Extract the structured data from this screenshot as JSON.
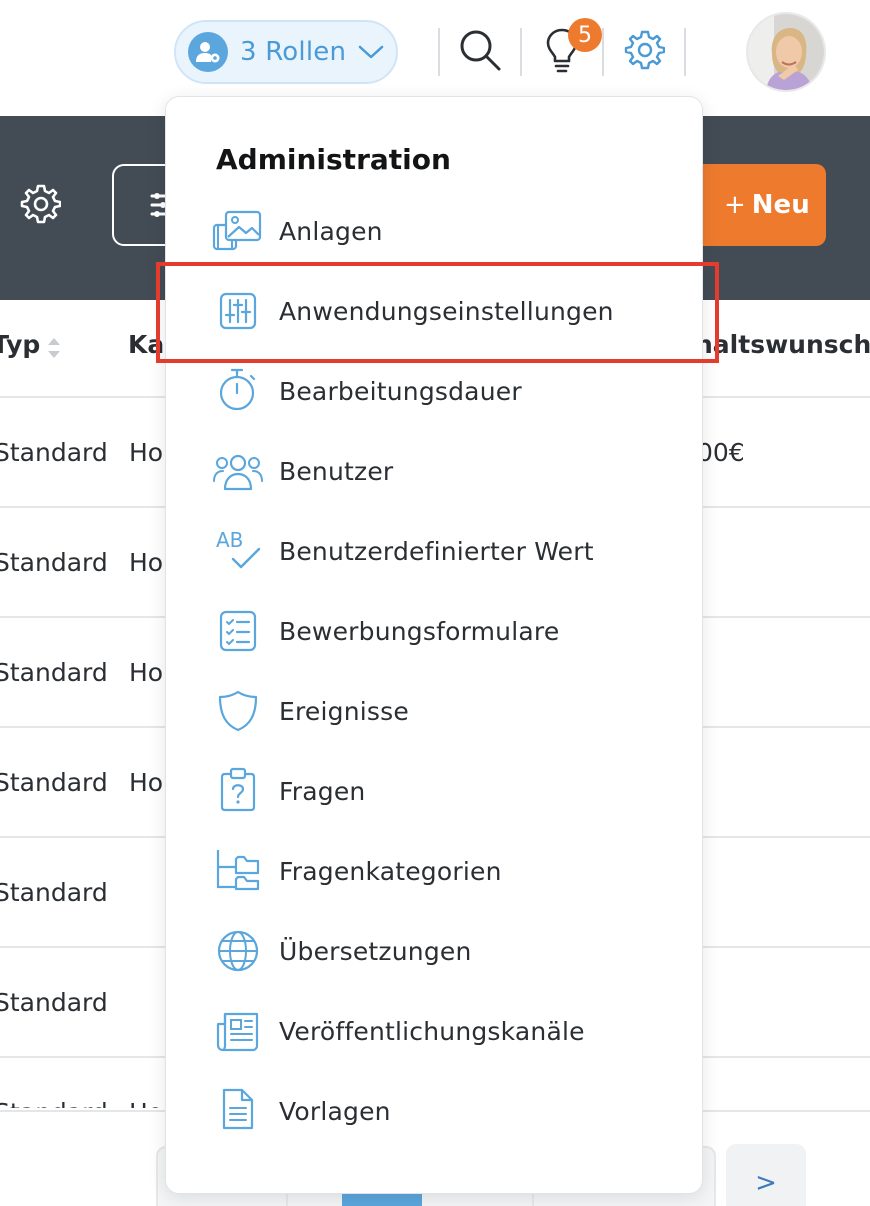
{
  "header": {
    "roles_label": "3 Rollen",
    "notification_count": "5",
    "icons": [
      "user-gear-icon",
      "chevron-down-icon",
      "search-icon",
      "lightbulb-icon",
      "gear-icon",
      "avatar"
    ]
  },
  "toolbar": {
    "new_button_label": "Neu",
    "icons": [
      "gear-icon",
      "filter-icon",
      "plus-icon"
    ]
  },
  "table": {
    "headers": [
      "Typ",
      "Ka",
      "haltswunsch"
    ],
    "rows": [
      {
        "typ": "Standard",
        "ka": "Ho",
        "gehalt": "00€"
      },
      {
        "typ": "Standard",
        "ka": "Ho",
        "gehalt": ""
      },
      {
        "typ": "Standard",
        "ka": "Ho",
        "gehalt": ""
      },
      {
        "typ": "Standard",
        "ka": "Ho",
        "gehalt": ""
      },
      {
        "typ": "Standard",
        "ka": "",
        "gehalt": ""
      },
      {
        "typ": "Standard",
        "ka": "",
        "gehalt": ""
      },
      {
        "typ": "Standard",
        "ka": "Ho",
        "gehalt": ""
      }
    ]
  },
  "pagination": {
    "next_label": ">"
  },
  "menu": {
    "title": "Administration",
    "highlighted": "Anwendungseinstellungen",
    "items": [
      {
        "label": "Anlagen",
        "icon": "images-icon"
      },
      {
        "label": "Anwendungseinstellungen",
        "icon": "sliders-icon"
      },
      {
        "label": "Bearbeitungsdauer",
        "icon": "stopwatch-icon"
      },
      {
        "label": "Benutzer",
        "icon": "users-icon"
      },
      {
        "label": "Benutzerdefinierter Wert",
        "icon": "ab-check-icon"
      },
      {
        "label": "Bewerbungsformulare",
        "icon": "checklist-icon"
      },
      {
        "label": "Ereignisse",
        "icon": "shield-icon"
      },
      {
        "label": "Fragen",
        "icon": "clipboard-question-icon"
      },
      {
        "label": "Fragenkategorien",
        "icon": "folder-tree-icon"
      },
      {
        "label": "Übersetzungen",
        "icon": "globe-icon"
      },
      {
        "label": "Veröffentlichungskanäle",
        "icon": "newspaper-icon"
      },
      {
        "label": "Vorlagen",
        "icon": "document-icon"
      }
    ]
  },
  "colors": {
    "accent_blue": "#4a9ad6",
    "icon_blue": "#5aa6dd",
    "orange": "#ee7a2e",
    "dark_band": "#434b55",
    "highlight_red": "#e33b2d"
  }
}
